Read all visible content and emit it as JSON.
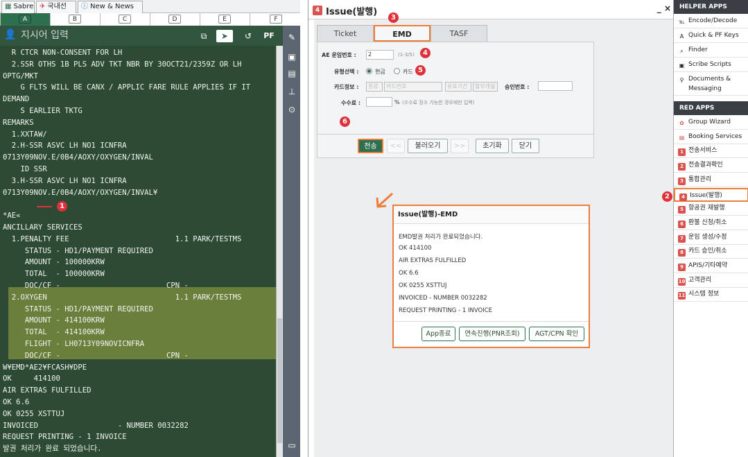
{
  "top_tabs": [
    {
      "label": "Sabre",
      "icon": "sabre-icon"
    },
    {
      "label": "국내선",
      "icon": "plane-icon"
    },
    {
      "label": "New & News",
      "icon": "info-icon"
    }
  ],
  "areas": [
    "A",
    "B",
    "C",
    "D",
    "E",
    "F"
  ],
  "command": {
    "placeholder": "지시어 입력",
    "pf_label": "PF"
  },
  "terminal_lines": [
    "  R CTCR NON-CONSENT FOR LH",
    "  2.SSR OTHS 1B PLS ADV TKT NBR BY 30OCT21/2359Z OR LH",
    "OPTG/MKT",
    "    G FLTS WILL BE CANX / APPLIC FARE RULE APPLIES IF IT",
    "DEMAND",
    "    S EARLIER TKTG",
    "REMARKS",
    "  1.XXTAW/",
    "  2.H-SSR ASVC LH NO1 ICNFRA",
    "0713Y09NOV.E/0B4/AOXY/OXYGEN/INVAL",
    "    ID SSR",
    "  3.H-SSR ASVC LH NO1 ICNFRA",
    "0713Y09NOV.E/0B4/AOXY/OXYGEN/INVAL¥",
    "",
    "*AE«",
    "ANCILLARY SERVICES",
    "  1.PENALTY FEE                        1.1 PARK/TESTMS",
    "     STATUS - HD1/PAYMENT REQUIRED",
    "     AMOUNT - 100000KRW",
    "     TOTAL  - 100000KRW",
    "     DOC/CF -                        CPN -",
    "  2.OXYGEN                             1.1 PARK/TESTMS",
    "     STATUS - HD1/PAYMENT REQUIRED",
    "     AMOUNT - 414100KRW",
    "     TOTAL  - 414100KRW",
    "     FLIGHT - LH0713Y09NOVICNFRA",
    "     DOC/CF -                        CPN -",
    "W¥EMD*AE2¥FCASH¥DPE",
    "OK     414100",
    "AIR EXTRAS FULFILLED",
    "OK 6.6",
    "OK 0255 XSTTUJ",
    "INVOICED                  - NUMBER 0032282",
    "REQUEST PRINTING - 1 INVOICE",
    "발권 처리가 완료 되었습니다."
  ],
  "markers": [
    "1",
    "2",
    "3",
    "4",
    "5",
    "6"
  ],
  "mid": {
    "number": "4",
    "title": "Issue(발행)",
    "controls": "_ ×",
    "tabs": [
      "Ticket",
      "EMD",
      "TASF"
    ],
    "form": {
      "ae_label": "AE 운임번호 :",
      "ae_value": "2",
      "ae_hint": "(1-3/5)",
      "type_label": "유형선택 :",
      "opt_cash": "현금",
      "opt_card": "카드",
      "card_label": "카드정보 :",
      "card_ph1": "종류",
      "card_ph2": "카드번호",
      "card_ph3": "유효기간",
      "card_ph4": "할부개월",
      "approval_label": "승인번호 :",
      "fee_label": "수수료 :",
      "fee_unit": "%",
      "fee_hint": "(수수료 징수 가능한 경우에만 입력)"
    },
    "buttons": {
      "send": "전송",
      "prev": "<<",
      "load": "불러오기",
      "next": ">>",
      "reset": "초기화",
      "close": "닫기"
    }
  },
  "popup": {
    "title": "Issue(발행)-EMD",
    "lines": [
      "EMD발권 처리가 완료되었습니다.",
      "OK 414100",
      "AIR EXTRAS FULFILLED",
      "OK 6.6",
      "OK 0255 XSTTUJ",
      "INVOICED - NUMBER 0032282",
      "REQUEST PRINTING - 1 INVOICE"
    ],
    "btn_exit": "App종료",
    "btn_continue": "연속진행(PNR조회)",
    "btn_agt": "AGT/CPN 확인"
  },
  "right": {
    "helper_title": "HELPER APPS",
    "helper_items": [
      {
        "label": "Encode/Decode",
        "icon": "encode-icon",
        "glyph": "℡"
      },
      {
        "label": "Quick & PF Keys",
        "icon": "keys-icon",
        "glyph": "A"
      },
      {
        "label": "Finder",
        "icon": "finder-icon",
        "glyph": "⌕"
      },
      {
        "label": "Scribe Scripts",
        "icon": "scripts-icon",
        "glyph": "▣"
      },
      {
        "label": "Documents &",
        "icon": "pin-icon",
        "glyph": "⚲"
      }
    ],
    "helper_item_extra": "Messaging",
    "red_title": "RED APPS",
    "red_items": [
      {
        "label": "Group Wizard",
        "icon": "group-icon",
        "glyph": "✿"
      },
      {
        "label": "Booking Services",
        "icon": "booking-icon",
        "glyph": "▤"
      },
      {
        "label": "전송서비스",
        "num": "1"
      },
      {
        "label": "전송결과확인",
        "num": "2"
      },
      {
        "label": "통합관리",
        "num": "3"
      },
      {
        "label": "Issue(발행)",
        "num": "4"
      },
      {
        "label": "항공권 재발행",
        "num": "5"
      },
      {
        "label": "환불 신청/취소",
        "num": "6"
      },
      {
        "label": "운임 생성/수정",
        "num": "7"
      },
      {
        "label": "카드 승인/취소",
        "num": "8"
      },
      {
        "label": "APIS/기타예약",
        "num": "9"
      },
      {
        "label": "고객관리",
        "num": "10"
      },
      {
        "label": "시스템 정보",
        "num": "11"
      }
    ]
  }
}
